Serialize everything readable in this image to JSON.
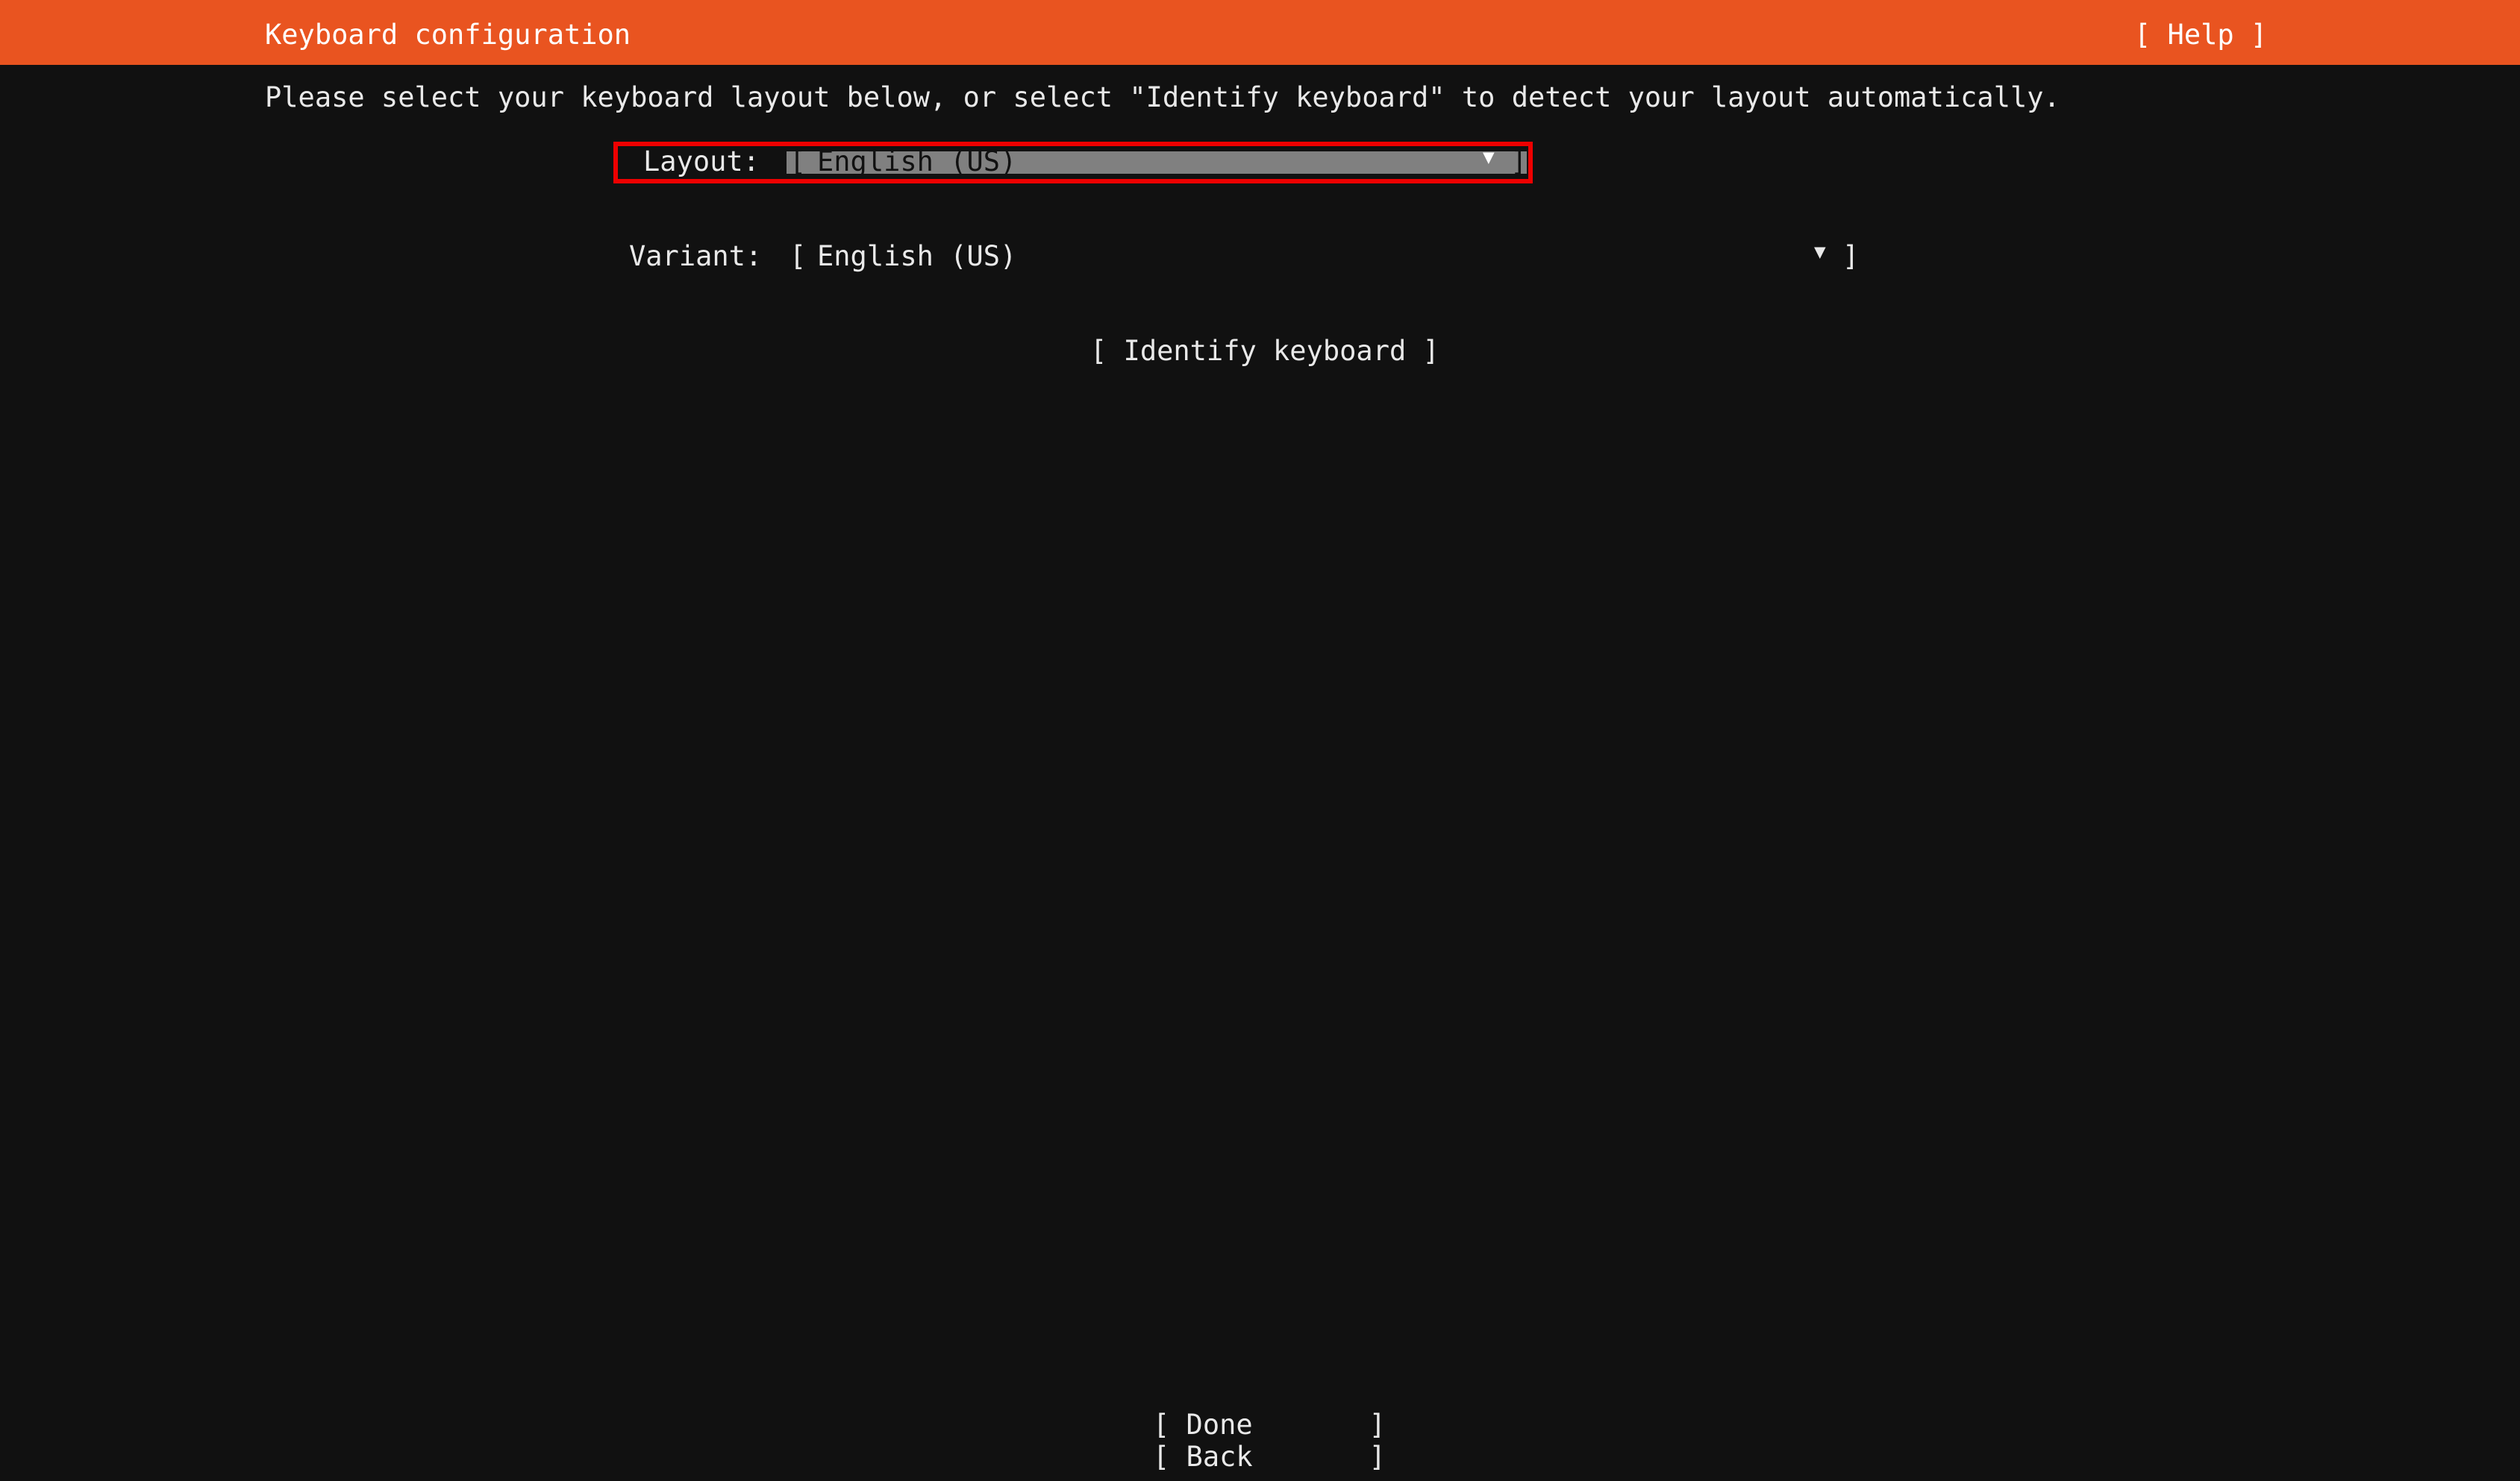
{
  "header": {
    "title": "Keyboard configuration",
    "help": "[ Help ]"
  },
  "instructions": "Please select your keyboard layout below, or select \"Identify keyboard\" to detect your layout automatically.",
  "layout_field": {
    "label": "Layout:",
    "bracket_open": "[",
    "value": "English (US)",
    "arrow": "▼",
    "bracket_close": "]"
  },
  "variant_field": {
    "label": "Variant:",
    "bracket_open": "[",
    "value": "English (US)",
    "arrow": "▼",
    "bracket_close": "]"
  },
  "identify_button": "[ Identify keyboard ]",
  "footer": {
    "done": "[ Done       ]",
    "back": "[ Back       ]"
  },
  "colors": {
    "header_bg": "#e95420",
    "page_bg": "#111111",
    "focus_outline": "#ee0000",
    "selected_bg": "#808080"
  }
}
